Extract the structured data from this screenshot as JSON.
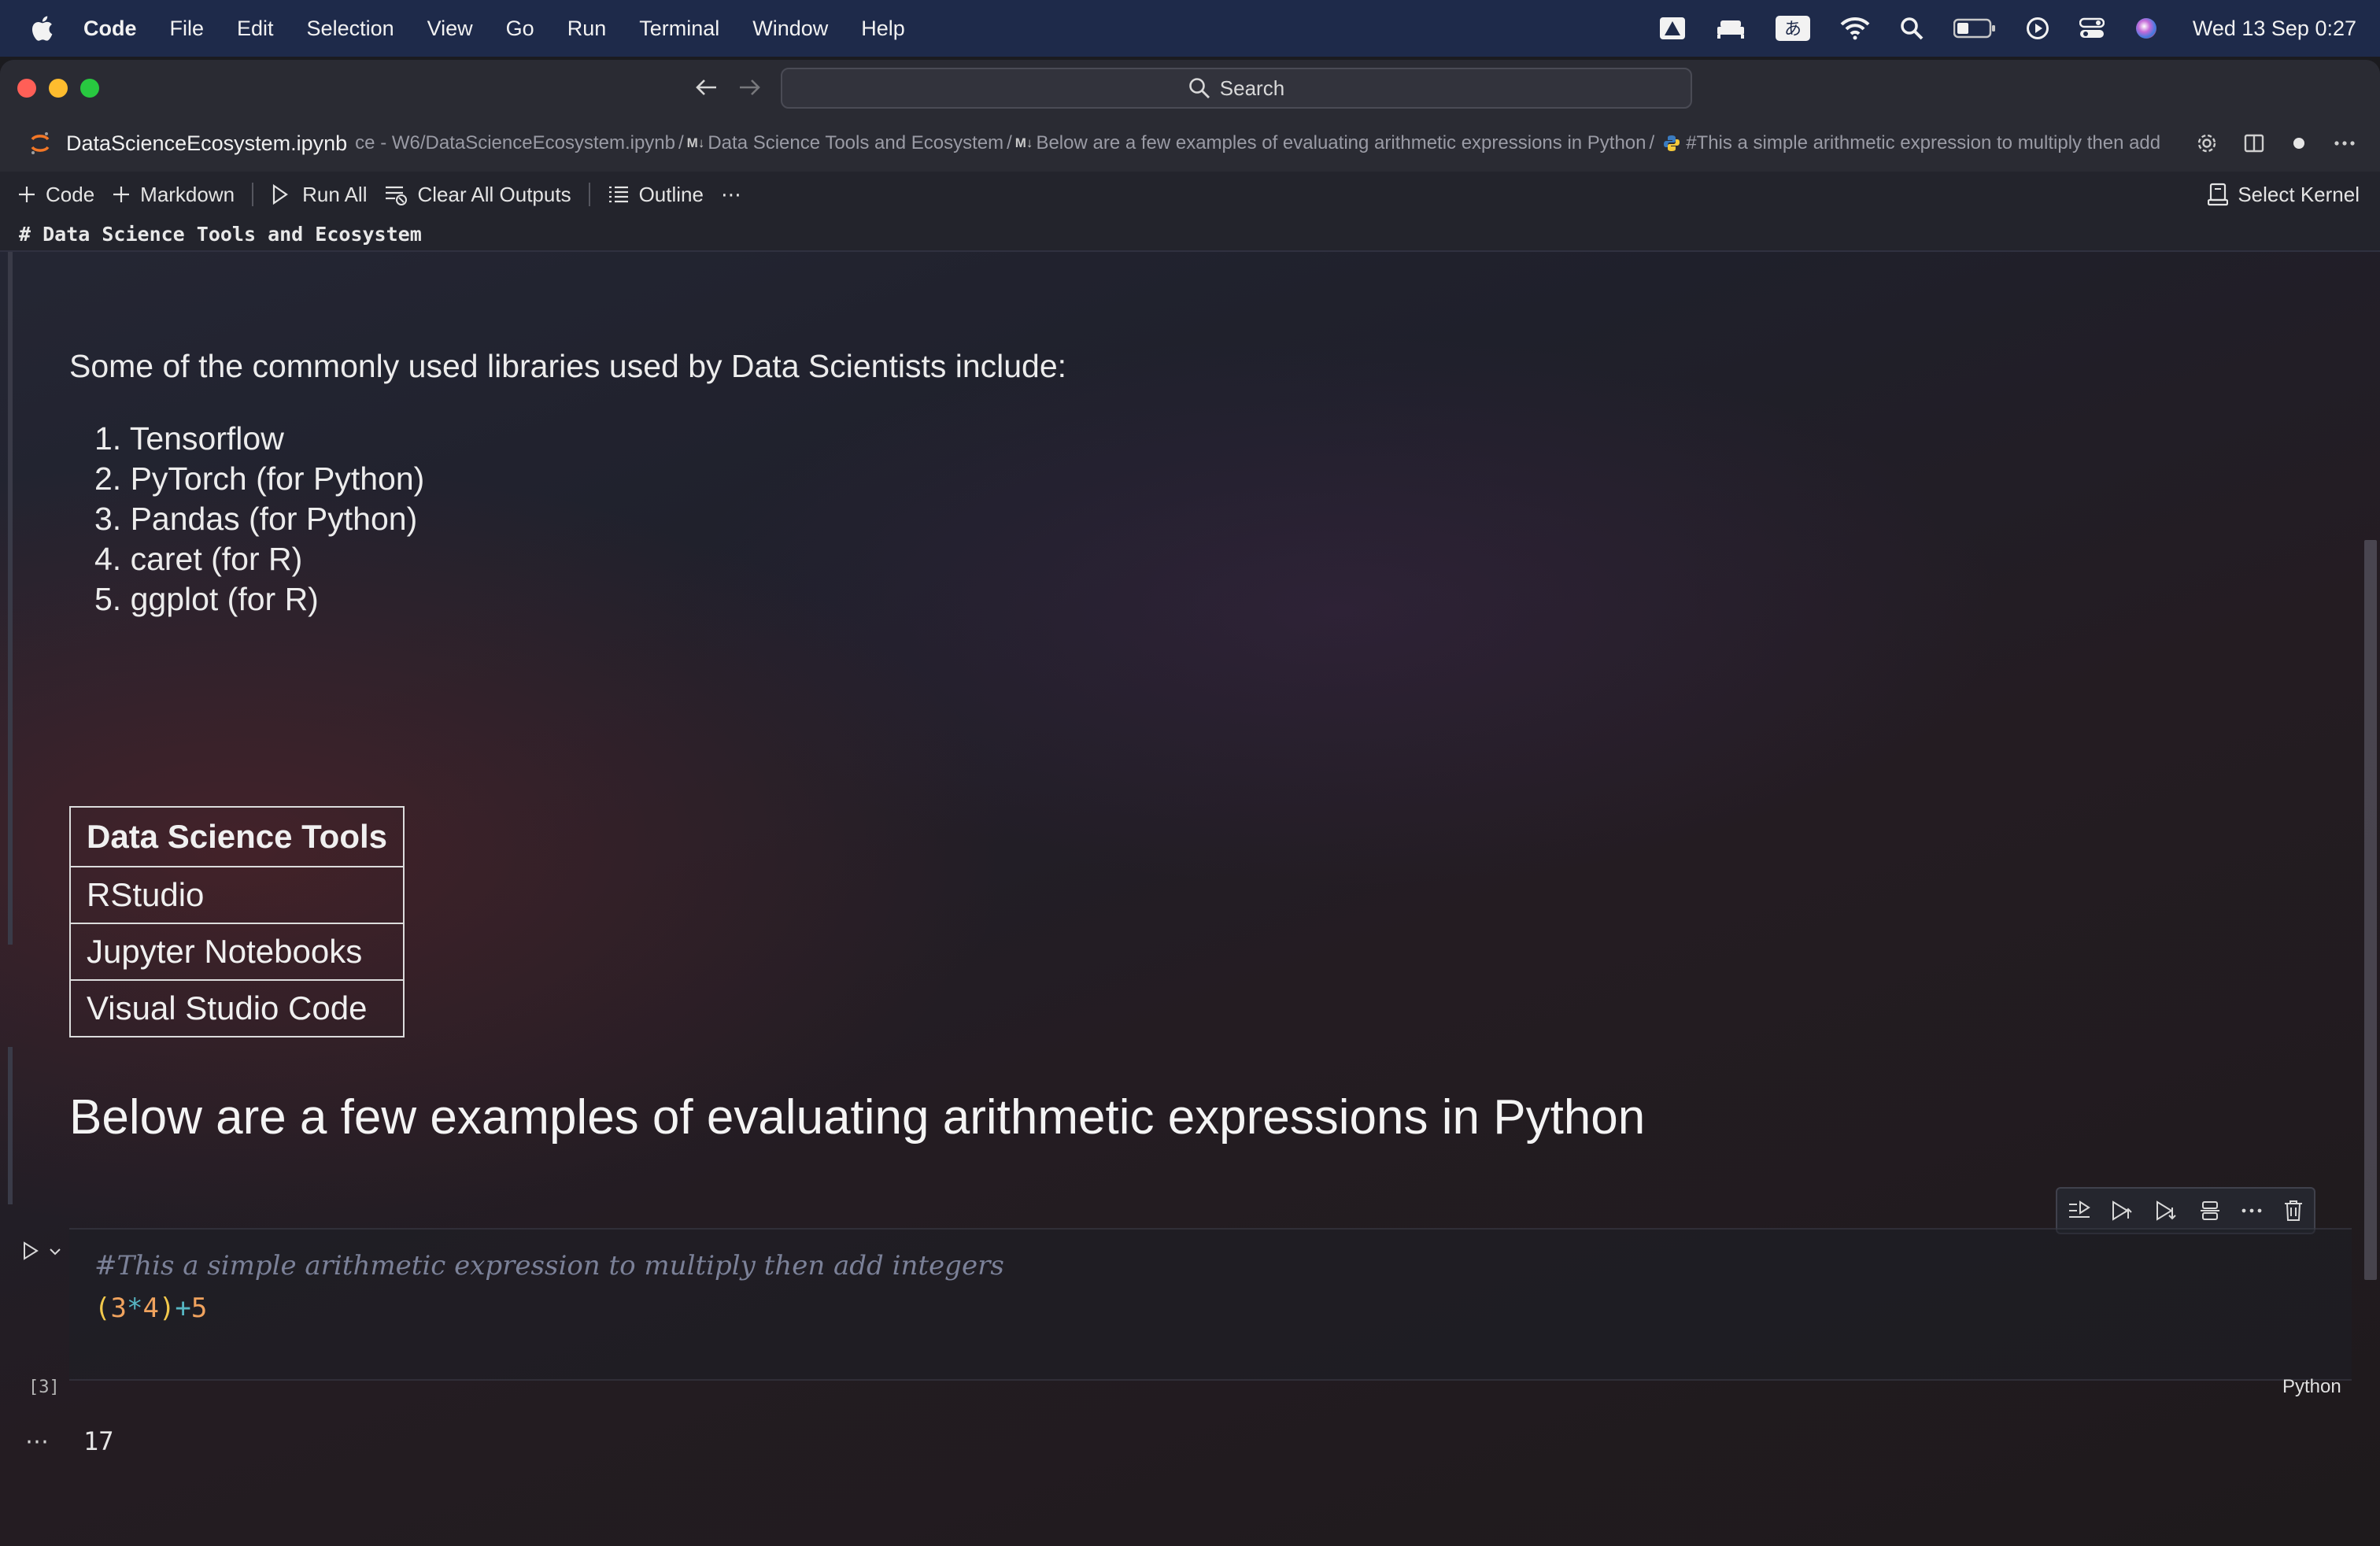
{
  "menubar": {
    "app_name": "Code",
    "items": [
      "File",
      "Edit",
      "Selection",
      "View",
      "Go",
      "Run",
      "Terminal",
      "Window",
      "Help"
    ],
    "ime_label": "あ",
    "clock": "Wed 13 Sep  0:27"
  },
  "window": {
    "search_placeholder": "Search",
    "tab_title": "DataScienceEcosystem.ipynb",
    "breadcrumb_prefix": "ce - W6/DataScienceEcosystem.ipynb",
    "breadcrumb_md1": "Data Science Tools and Ecosystem",
    "breadcrumb_md2": "Below are a few examples of evaluating arithmetic expressions in Python",
    "breadcrumb_code": "#This a simple arithmetic expression to multiply then add",
    "md_badge": "M↓"
  },
  "toolbar": {
    "code_label": "Code",
    "markdown_label": "Markdown",
    "run_all_label": "Run All",
    "clear_outputs_label": "Clear All Outputs",
    "outline_label": "Outline",
    "more_label": "⋯",
    "kernel_label": "Select Kernel"
  },
  "sticky_header": "# Data Science Tools and Ecosystem",
  "notebook": {
    "libraries_intro": "Some of the commonly used libraries used by Data Scientists include:",
    "libraries": [
      "1. Tensorflow",
      "2. PyTorch (for Python)",
      "3. Pandas (for Python)",
      "4. caret (for R)",
      "5. ggplot (for R)"
    ],
    "tools_table": {
      "header": "Data Science Tools",
      "rows": [
        "RStudio",
        "Jupyter Notebooks",
        "Visual Studio Code"
      ]
    },
    "heading": "Below are a few examples of evaluating arithmetic expressions in Python",
    "code_cell": {
      "comment": "#This a simple arithmetic expression to multiply then add integers",
      "tokens": {
        "open_paren": "(",
        "num1": "3",
        "op_mul": "*",
        "num2": "4",
        "close_paren": ")",
        "op_add": "+",
        "num3": "5"
      },
      "execution_count": "[3]",
      "language": "Python"
    },
    "output": {
      "dots": "⋯",
      "value": "17"
    }
  },
  "colors": {
    "menubar_bg": "#1e2a4a",
    "paren": "#f2c94c",
    "number": "#f0a35e",
    "operator": "#56b6c2"
  }
}
